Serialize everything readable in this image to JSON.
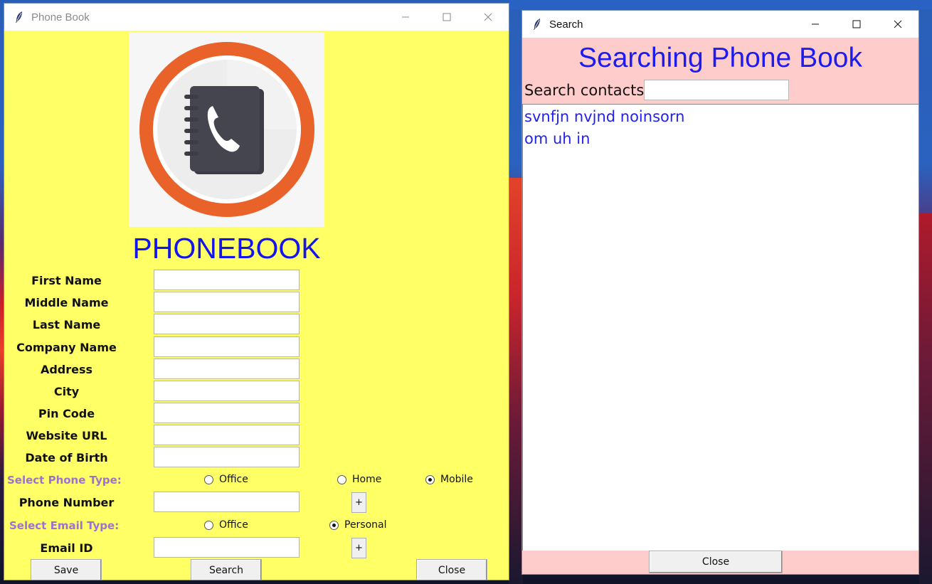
{
  "phonebook_window": {
    "title": "Phone Book",
    "heading": "PHONEBOOK",
    "fields": [
      {
        "label": "First Name",
        "value": ""
      },
      {
        "label": "Middle Name",
        "value": ""
      },
      {
        "label": "Last Name",
        "value": ""
      },
      {
        "label": "Company Name",
        "value": ""
      },
      {
        "label": "Address",
        "value": ""
      },
      {
        "label": "City",
        "value": ""
      },
      {
        "label": "Pin Code",
        "value": ""
      },
      {
        "label": "Website URL",
        "value": ""
      },
      {
        "label": "Date of Birth",
        "value": ""
      }
    ],
    "phone_type": {
      "label": "Select Phone Type:",
      "options": [
        "Office",
        "Home",
        "Mobile"
      ],
      "selected": "Mobile"
    },
    "phone_number": {
      "label": "Phone Number",
      "value": "",
      "add_label": "+"
    },
    "email_type": {
      "label": "Select Email Type:",
      "options": [
        "Office",
        "Personal"
      ],
      "selected": "Personal"
    },
    "email": {
      "label": "Email ID",
      "value": "",
      "add_label": "+"
    },
    "buttons": {
      "save": "Save",
      "search": "Search",
      "close": "Close"
    }
  },
  "search_window": {
    "title": "Search",
    "heading": "Searching Phone Book",
    "search_label": "Search contacts",
    "search_value": "",
    "results": [
      "svnfjn nvjnd noinsorn",
      "om uh in"
    ],
    "close_label": "Close"
  },
  "colors": {
    "phonebook_bg": "#ffff66",
    "search_bg": "#ffcccc",
    "heading_blue": "#1414ee",
    "section_purple": "#a070d0",
    "logo_orange": "#e8622a"
  },
  "icons": {
    "window_icon": "tk-feather-icon",
    "logo": "phonebook-logo-icon"
  }
}
